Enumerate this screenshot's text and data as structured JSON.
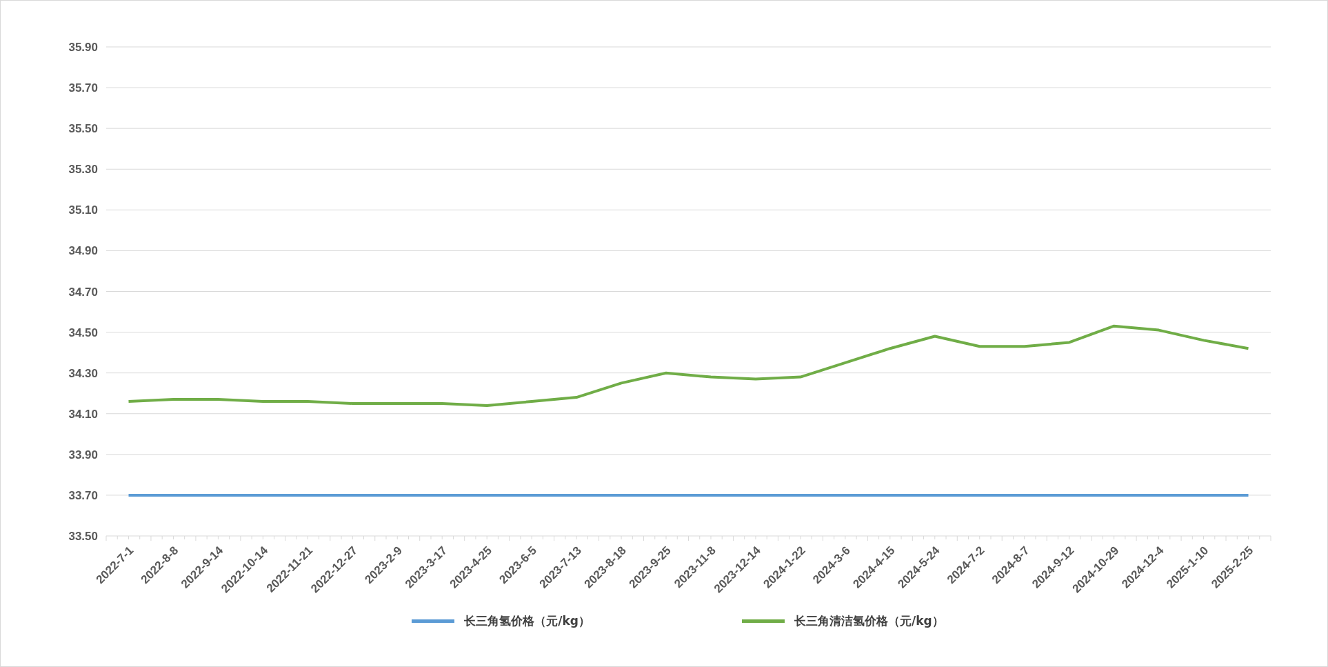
{
  "chart": {
    "chart_data": {
      "type": "line",
      "categories": [
        "2022-7-1",
        "2022-8-8",
        "2022-9-14",
        "2022-10-14",
        "2022-11-21",
        "2022-12-27",
        "2023-2-9",
        "2023-3-17",
        "2023-4-25",
        "2023-6-5",
        "2023-7-13",
        "2023-8-18",
        "2023-9-25",
        "2023-11-8",
        "2023-12-14",
        "2024-1-22",
        "2024-3-6",
        "2024-4-15",
        "2024-5-24",
        "2024-7-2",
        "2024-8-7",
        "2024-9-12",
        "2024-10-29",
        "2024-12-4",
        "2025-1-10",
        "2025-2-25"
      ],
      "series": [
        {
          "name": "长三角氢价格（元/kg）",
          "color": "#5b9bd5",
          "values": [
            33.7,
            33.7,
            33.7,
            33.7,
            33.7,
            33.7,
            33.7,
            33.7,
            33.7,
            33.7,
            33.7,
            33.7,
            33.7,
            33.7,
            33.7,
            33.7,
            33.7,
            33.7,
            33.7,
            33.7,
            33.7,
            33.7,
            33.7,
            33.7,
            33.7,
            33.7
          ]
        },
        {
          "name": "长三角清洁氢价格（元/kg）",
          "color": "#70ad47",
          "values": [
            34.16,
            34.17,
            34.17,
            34.16,
            34.16,
            34.15,
            34.15,
            34.15,
            34.14,
            34.16,
            34.18,
            34.25,
            34.3,
            34.28,
            34.27,
            34.28,
            34.35,
            34.42,
            34.48,
            34.43,
            34.43,
            34.45,
            34.53,
            34.51,
            34.46,
            34.42
          ]
        }
      ],
      "ylim": [
        33.5,
        35.9
      ],
      "grid": true,
      "legend": true,
      "yticks": [
        {
          "value": 33.5,
          "label": "33.50"
        },
        {
          "value": 33.7,
          "label": "33.70"
        },
        {
          "value": 33.9,
          "label": "33.90"
        },
        {
          "value": 34.1,
          "label": "34.10"
        },
        {
          "value": 34.3,
          "label": "34.30"
        },
        {
          "value": 34.5,
          "label": "34.50"
        },
        {
          "value": 34.7,
          "label": "34.70"
        },
        {
          "value": 34.9,
          "label": "34.90"
        },
        {
          "value": 35.1,
          "label": "35.10"
        },
        {
          "value": 35.3,
          "label": "35.30"
        },
        {
          "value": 35.5,
          "label": "35.50"
        },
        {
          "value": 35.7,
          "label": "35.70"
        },
        {
          "value": 35.9,
          "label": "35.90"
        }
      ]
    }
  }
}
